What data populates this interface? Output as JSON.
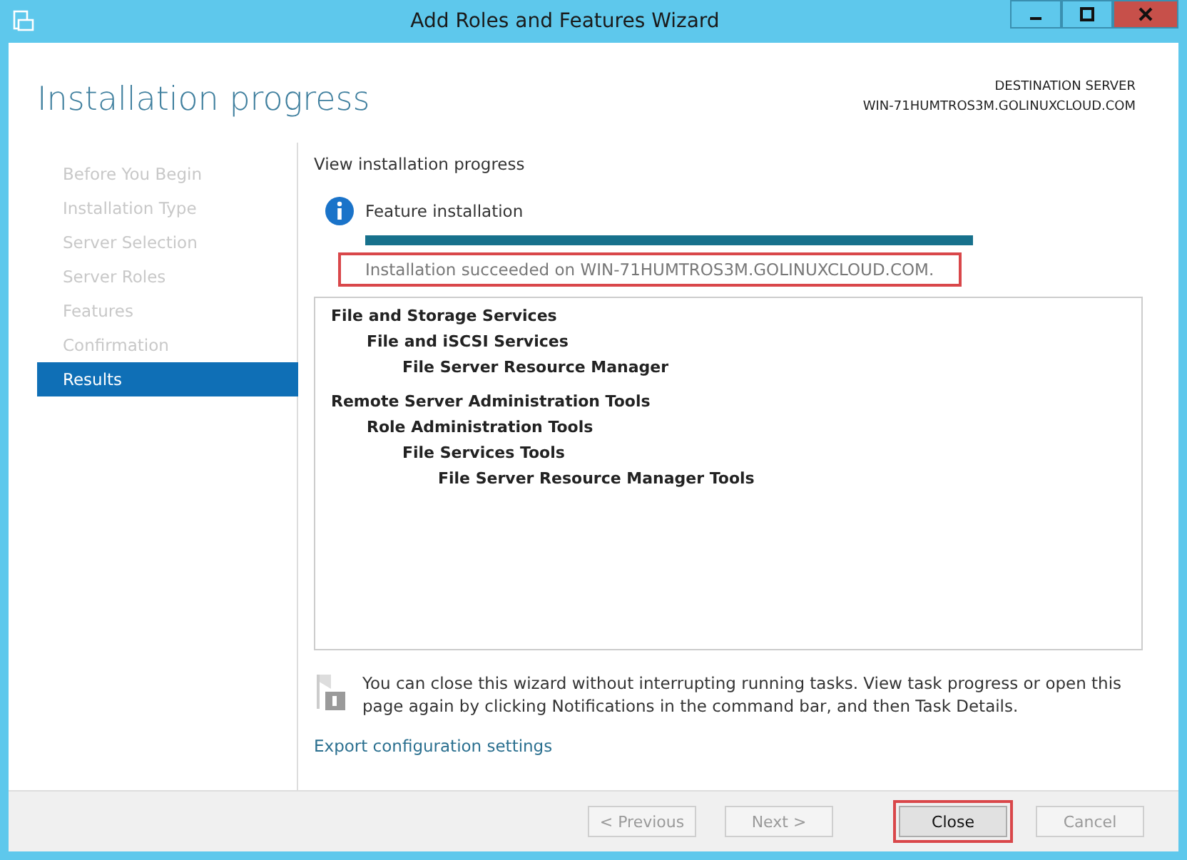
{
  "window": {
    "title": "Add Roles and Features Wizard"
  },
  "header": {
    "title": "Installation progress",
    "server_label": "DESTINATION SERVER",
    "server_name": "WIN-71HUMTROS3M.GOLINUXCLOUD.COM"
  },
  "steps": [
    {
      "label": "Before You Begin",
      "selected": false,
      "disabled": true
    },
    {
      "label": "Installation Type",
      "selected": false,
      "disabled": true
    },
    {
      "label": "Server Selection",
      "selected": false,
      "disabled": true
    },
    {
      "label": "Server Roles",
      "selected": false,
      "disabled": true
    },
    {
      "label": "Features",
      "selected": false,
      "disabled": true
    },
    {
      "label": "Confirmation",
      "selected": false,
      "disabled": true
    },
    {
      "label": "Results",
      "selected": true,
      "disabled": false
    }
  ],
  "progress": {
    "heading": "View installation progress",
    "task": "Feature installation",
    "level": 1,
    "status": "Installation succeeded on WIN-71HUMTROS3M.GOLINUXCLOUD.COM.",
    "highlighted": true
  },
  "results": [
    {
      "label": "File and Storage Services",
      "children": [
        {
          "label": "File and iSCSI Services",
          "children": [
            {
              "label": "File Server Resource Manager"
            }
          ]
        }
      ]
    },
    {
      "label": "Remote Server Administration Tools",
      "children": [
        {
          "label": "Role Administration Tools",
          "children": [
            {
              "label": "File Services Tools",
              "children": [
                {
                  "label": "File Server Resource Manager Tools"
                }
              ]
            }
          ]
        }
      ]
    }
  ],
  "note": "You can close this wizard without interrupting running tasks. View task progress or open this page again by clicking Notifications in the command bar, and then Task Details.",
  "export_link": "Export configuration settings",
  "buttons": [
    {
      "label": "< Previous",
      "disabled": true,
      "highlighted": false
    },
    {
      "label": "Next >",
      "disabled": true,
      "highlighted": false
    },
    {
      "label": "Close",
      "disabled": false,
      "highlighted": true
    },
    {
      "label": "Cancel",
      "disabled": true,
      "highlighted": false
    }
  ]
}
